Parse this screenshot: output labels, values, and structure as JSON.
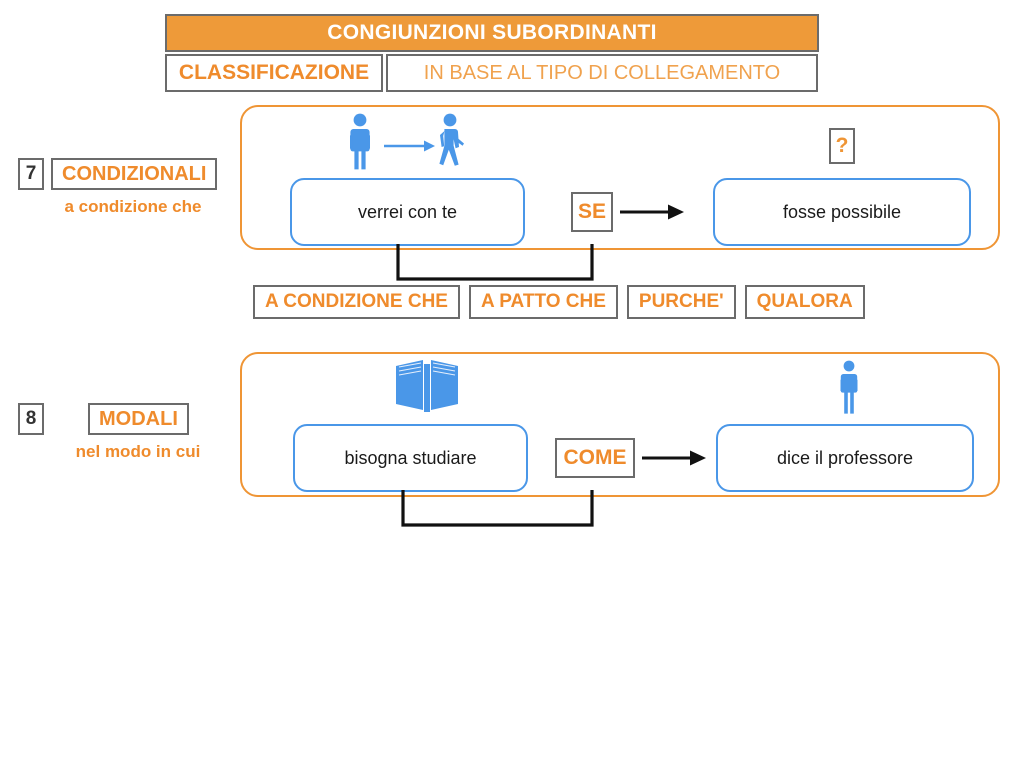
{
  "header": {
    "title": "CONGIUNZIONI SUBORDINANTI",
    "classification_label": "CLASSIFICAZIONE",
    "classification_value": "IN BASE AL TIPO DI COLLEGAMENTO"
  },
  "colors": {
    "title_bar_bg": "#ee9a39",
    "orange_text": "#ef8b2c",
    "orange_light": "#f0a24e",
    "panel_border": "#ef9535",
    "clause_border": "#4a97e8",
    "figure_blue": "#4a97e8",
    "box_border": "#6b6b6b",
    "body_text": "#1a1a1a"
  },
  "sections": [
    {
      "number": "7",
      "name": "CONDIZIONALI",
      "subtitle": "a condizione che",
      "left_clause": "verrei con te",
      "conjunction": "SE",
      "right_clause": "fosse possibile",
      "badge": "?",
      "left_icon": "two-people-walking-icon",
      "right_icon": "question-badge",
      "alternatives": [
        "A CONDIZIONE CHE",
        "A PATTO CHE",
        "PURCHE'",
        "QUALORA"
      ]
    },
    {
      "number": "8",
      "name": "MODALI",
      "subtitle": "nel modo in cui",
      "left_clause": "bisogna studiare",
      "conjunction": "COME",
      "right_clause": "dice il professore",
      "badge": "",
      "left_icon": "open-book-icon",
      "right_icon": "standing-person-icon",
      "alternatives": []
    }
  ]
}
